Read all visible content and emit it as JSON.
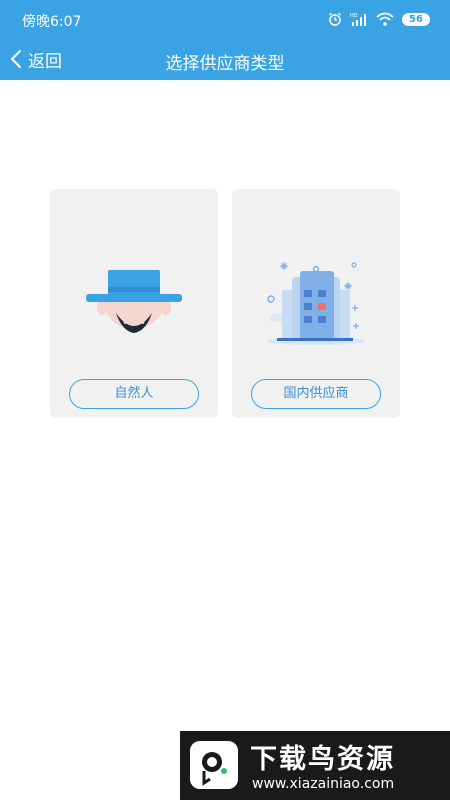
{
  "status_bar": {
    "time": "傍晚6:07",
    "icons": [
      "alarm-icon",
      "hd-signal-icon",
      "wifi-icon",
      "battery-icon"
    ],
    "battery_level": "56"
  },
  "nav": {
    "back_label": "返回",
    "title": "选择供应商类型"
  },
  "cards": [
    {
      "label": "自然人",
      "icon": "person-hat-icon"
    },
    {
      "label": "国内供应商",
      "icon": "building-icon"
    }
  ],
  "watermark": {
    "title": "下载鸟资源",
    "url": "www.xiazainiao.com"
  },
  "colors": {
    "header": "#3aa3e3",
    "card_bg": "#f1f1f1",
    "button_border": "#3aa3e3",
    "button_text": "#3a8fcf"
  }
}
